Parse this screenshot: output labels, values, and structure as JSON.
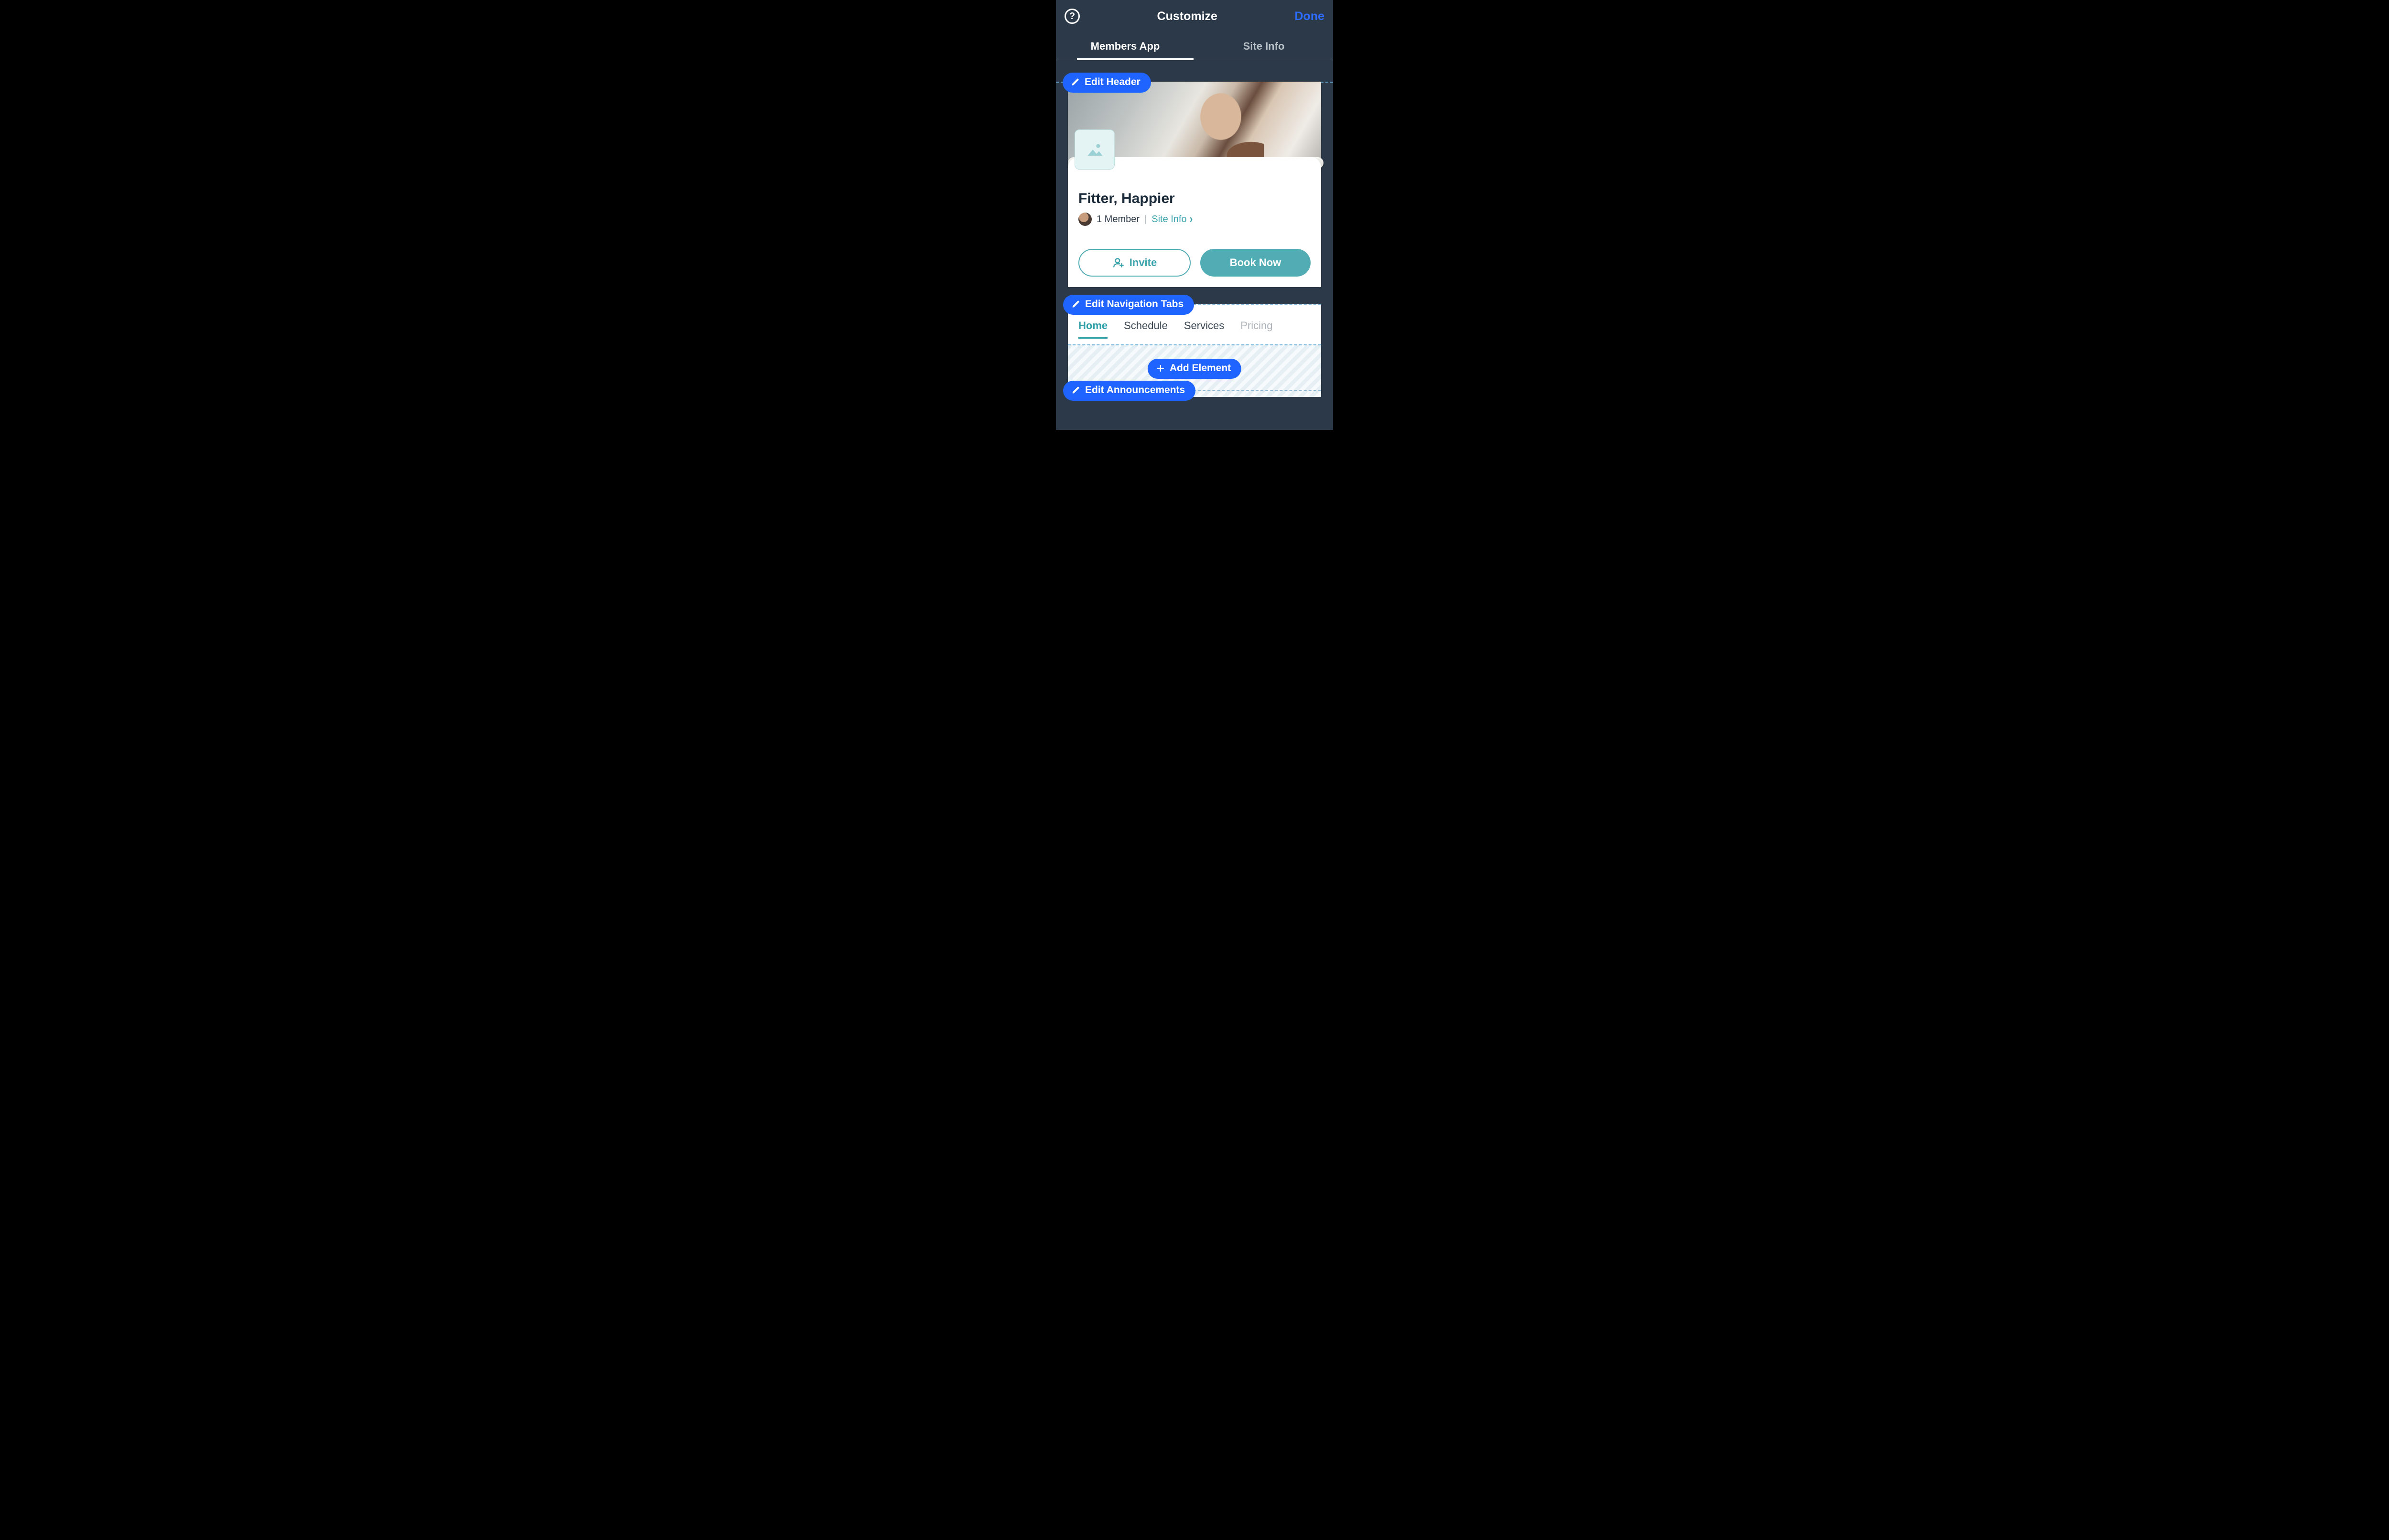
{
  "topbar": {
    "title": "Customize",
    "done": "Done"
  },
  "tabs": {
    "members_app": "Members App",
    "site_info": "Site Info"
  },
  "pills": {
    "edit_header": "Edit Header",
    "edit_nav": "Edit Navigation Tabs",
    "add_element": "Add Element",
    "edit_announcements": "Edit Announcements"
  },
  "site": {
    "title": "Fitter, Happier",
    "members": "1 Member",
    "site_info_link": "Site Info"
  },
  "cta": {
    "invite": "Invite",
    "book_now": "Book Now"
  },
  "nav": {
    "home": "Home",
    "schedule": "Schedule",
    "services": "Services",
    "pricing": "Pricing"
  }
}
